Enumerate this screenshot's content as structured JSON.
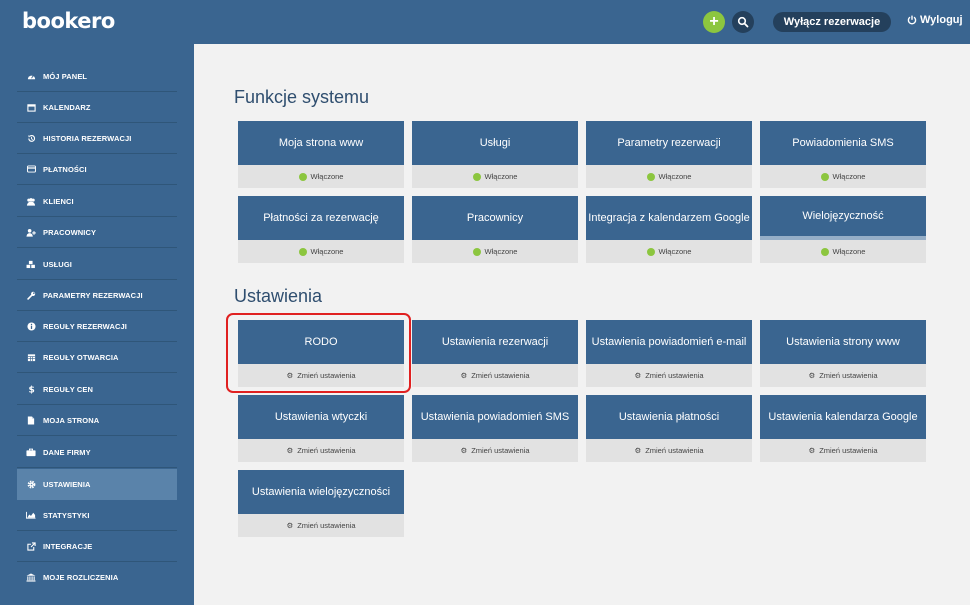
{
  "header": {
    "logo": "bookero",
    "add_label": "+",
    "disable_label": "Wyłącz rezerwacje",
    "logout_label": "Wyloguj"
  },
  "sidebar": {
    "items": [
      {
        "label": "MÓJ PANEL",
        "icon": "dashboard-icon"
      },
      {
        "label": "KALENDARZ",
        "icon": "calendar-icon"
      },
      {
        "label": "HISTORIA REZERWACJI",
        "icon": "history-icon"
      },
      {
        "label": "PŁATNOŚCI",
        "icon": "credit-card-icon"
      },
      {
        "label": "KLIENCI",
        "icon": "users-icon"
      },
      {
        "label": "PRACOWNICY",
        "icon": "user-plus-icon"
      },
      {
        "label": "USŁUGI",
        "icon": "cubes-icon"
      },
      {
        "label": "PARAMETRY REZERWACJI",
        "icon": "wrench-icon"
      },
      {
        "label": "REGUŁY REZERWACJI",
        "icon": "info-icon"
      },
      {
        "label": "REGUŁY OTWARCIA",
        "icon": "calendar-grid-icon"
      },
      {
        "label": "REGUŁY CEN",
        "icon": "dollar-icon"
      },
      {
        "label": "MOJA STRONA",
        "icon": "file-icon"
      },
      {
        "label": "DANE FIRMY",
        "icon": "briefcase-icon"
      },
      {
        "label": "USTAWIENIA",
        "icon": "gear-icon",
        "active": true
      },
      {
        "label": "STATYSTYKI",
        "icon": "area-chart-icon"
      },
      {
        "label": "INTEGRACJE",
        "icon": "external-link-icon"
      },
      {
        "label": "MOJE ROZLICZENIA",
        "icon": "bank-icon"
      }
    ]
  },
  "sections": {
    "functions": {
      "title": "Funkcje systemu",
      "tiles": [
        {
          "title": "Moja strona www",
          "status": "Włączone"
        },
        {
          "title": "Usługi",
          "status": "Włączone"
        },
        {
          "title": "Parametry rezerwacji",
          "status": "Włączone"
        },
        {
          "title": "Powiadomienia SMS",
          "status": "Włączone"
        },
        {
          "title": "Płatności za rezerwację",
          "status": "Włączone"
        },
        {
          "title": "Pracownicy",
          "status": "Włączone"
        },
        {
          "title": "Integracja z kalendarzem Google",
          "status": "Włączone"
        },
        {
          "title": "Wielojęzyczność",
          "status": "Włączone"
        }
      ]
    },
    "settings": {
      "title": "Ustawienia",
      "tiles": [
        {
          "title": "RODO",
          "action": "Zmień ustawienia"
        },
        {
          "title": "Ustawienia rezerwacji",
          "action": "Zmień ustawienia"
        },
        {
          "title": "Ustawienia powiadomień e-mail",
          "action": "Zmień ustawienia"
        },
        {
          "title": "Ustawienia strony www",
          "action": "Zmień ustawienia"
        },
        {
          "title": "Ustawienia wtyczki",
          "action": "Zmień ustawienia"
        },
        {
          "title": "Ustawienia powiadomień SMS",
          "action": "Zmień ustawienia"
        },
        {
          "title": "Ustawienia płatności",
          "action": "Zmień ustawienia"
        },
        {
          "title": "Ustawienia kalendarza Google",
          "action": "Zmień ustawienia"
        },
        {
          "title": "Ustawienia wielojęzyczności",
          "action": "Zmień ustawienia"
        }
      ]
    }
  },
  "colors": {
    "brand_blue": "#3a6590",
    "dark_blue": "#24405c",
    "accent_green": "#8cc63f",
    "highlight_red": "#e02020"
  }
}
